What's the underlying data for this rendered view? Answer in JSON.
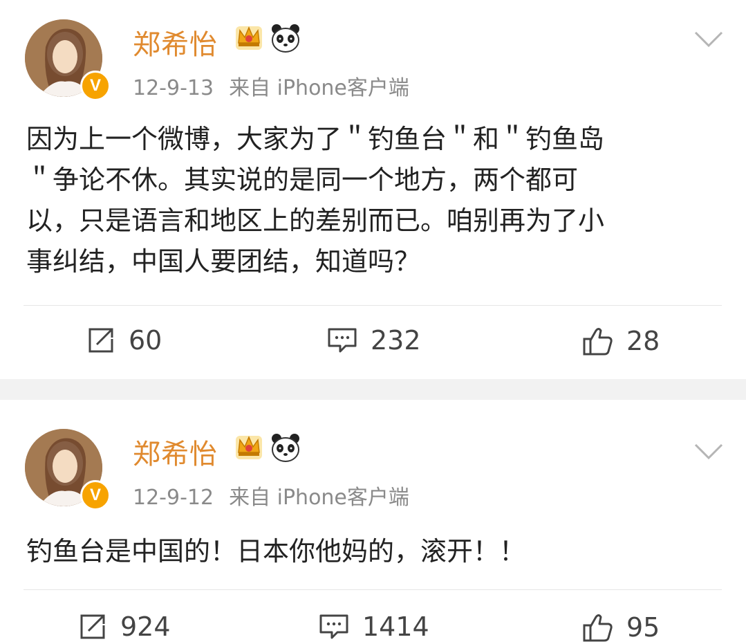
{
  "colors": {
    "username": "#e08a2f",
    "meta": "#8a8a8a",
    "verified_badge": "#f7a300",
    "separator": "#f2f2f2"
  },
  "posts": [
    {
      "username": "郑希怡",
      "date": "12-9-13",
      "source": "来自 iPhone客户端",
      "text_lines": [
        "因为上一个微博，大家为了＂钓鱼台＂和＂钓鱼岛",
        "＂争论不休。其实说的是同一个地方，两个都可",
        "以，只是语言和地区上的差别而已。咱别再为了小",
        "事纠结，中国人要团结，知道吗？"
      ],
      "reposts": "60",
      "comments": "232",
      "likes": "28"
    },
    {
      "username": "郑希怡",
      "date": "12-9-12",
      "source": "来自 iPhone客户端",
      "text_lines": [
        "钓鱼台是中国的！日本你他妈的，滚开！！"
      ],
      "reposts": "924",
      "comments": "1414",
      "likes": "95"
    }
  ],
  "icons": {
    "verified_badge": "V",
    "crown": "crown-icon",
    "panda": "panda-icon",
    "chevron": "chevron-down-icon",
    "repost": "repost-icon",
    "comment": "comment-icon",
    "like": "thumbs-up-icon"
  }
}
